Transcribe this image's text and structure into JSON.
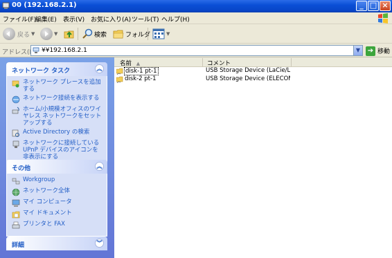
{
  "window": {
    "title": "00 (192.168.2.1)",
    "controls": {
      "minimize": "_",
      "maximize": "□",
      "close": "×"
    }
  },
  "menubar": {
    "items": [
      "ファイル(F)",
      "編集(E)",
      "表示(V)",
      "お気に入り(A)",
      "ツール(T)",
      "ヘルプ(H)"
    ]
  },
  "toolbar": {
    "back_label": "戻る",
    "search_label": "検索",
    "folder_label": "フォルダ"
  },
  "address": {
    "label": "アドレス(D)",
    "value": "¥¥192.168.2.1",
    "go_label": "移動"
  },
  "taskpane": {
    "network_tasks": {
      "title": "ネットワーク タスク",
      "items": [
        "ネットワーク プレースを追加する",
        "ネットワーク接続を表示する",
        "ホーム/小規模オフィスのワイヤレス ネットワークをセットアップする",
        "Active Directory の検索",
        "ネットワークに接続している UPnP デバイスのアイコンを非表示にする"
      ]
    },
    "other": {
      "title": "その他",
      "items": [
        "Workgroup",
        "ネットワーク全体",
        "マイ コンピュータ",
        "マイ ドキュメント",
        "プリンタと FAX"
      ]
    },
    "details": {
      "title": "詳細"
    }
  },
  "list": {
    "columns": {
      "name": "名前",
      "comment": "コメント"
    },
    "rows": [
      {
        "name": "disk-1 pt-1",
        "comment": "USB Storage Device (LaCie/La..."
      },
      {
        "name": "disk-2 pt-1",
        "comment": "USB Storage Device (ELECOM..."
      }
    ]
  }
}
